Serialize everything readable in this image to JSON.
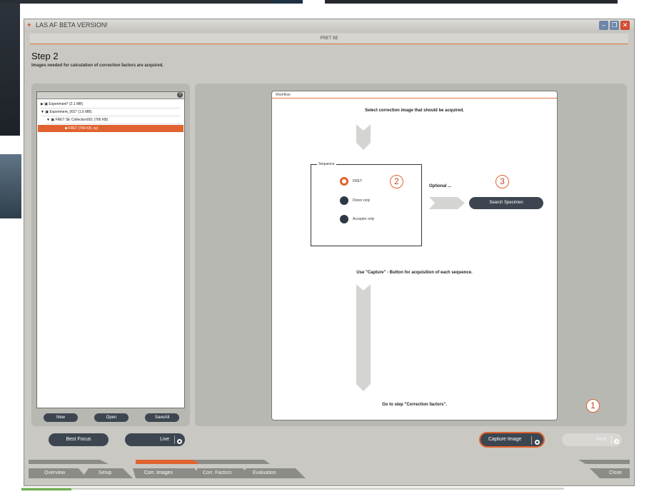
{
  "window": {
    "title": "LAS AF BETA VERSION!",
    "header": "FRET SE",
    "step_title": "Step 2",
    "step_desc": "Images needed for calculation of correction factors are acquired."
  },
  "tree": {
    "help_icon": "?",
    "items": [
      {
        "label": "Experiment* (2.1 MB)"
      },
      {
        "label": "Experiment_001* (1.6 MB)"
      },
      {
        "label": "FRET SE Collection001 (766 KB)"
      },
      {
        "label": "FRET (766 KB, xy)"
      }
    ],
    "buttons": {
      "new": "New",
      "open": "Open",
      "saveall": "SaveAll"
    }
  },
  "workflow": {
    "title": "Workflow",
    "select_text": "Select correction image that should be acquired.",
    "sequence_label": "Sequence",
    "options": [
      {
        "label": "FRET",
        "selected": true
      },
      {
        "label": "Donor only",
        "selected": false
      },
      {
        "label": "Acceptor only",
        "selected": false
      }
    ],
    "optional_label": "Optional ...",
    "search_button": "Search Specimen",
    "capture_text": "Use \"Capture\" - Button for acquisition of each sequence.",
    "goto_text": "Go to step \"Correction factors\"."
  },
  "callouts": {
    "one": "1",
    "two": "2",
    "three": "3"
  },
  "bottom": {
    "best_focus": "Best Focus",
    "live": "Live",
    "capture": "Capture Image",
    "next": "Next"
  },
  "tabs": [
    "Overview",
    "Setup",
    "Corr. Images",
    "Corr. Factors",
    "Evaluation"
  ],
  "active_tab_index": 2,
  "close": "Close",
  "colors": {
    "accent": "#e0622e",
    "dark_button": "#3d4650",
    "panel": "#b7b8b2"
  }
}
